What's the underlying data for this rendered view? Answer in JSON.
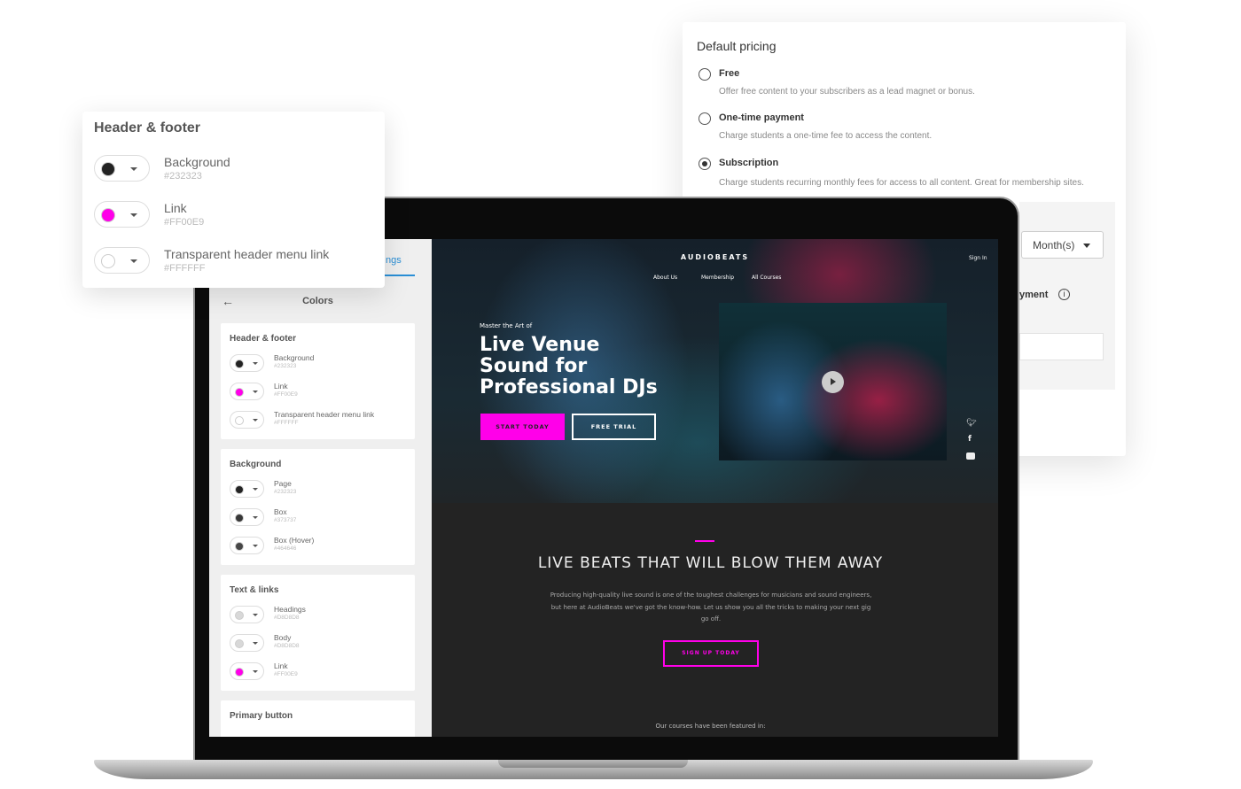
{
  "pricing": {
    "title": "Default pricing",
    "options": [
      {
        "label": "Free",
        "desc": "Offer free content to your subscribers as a lead magnet or bonus.",
        "selected": false
      },
      {
        "label": "One-time payment",
        "desc": "Charge students a one-time fee to access the content.",
        "selected": false
      },
      {
        "label": "Subscription",
        "desc": "Charge students recurring monthly fees for access to all content. Great for membership sites.",
        "selected": true
      }
    ],
    "period_select": "Month(s)",
    "partial_label": "yment",
    "info_icon": "i"
  },
  "sidebar": {
    "tab_partial": "ngs",
    "back_icon": "←",
    "title": "Colors",
    "accent": "#2A8FD6",
    "groups": [
      {
        "title": "Header & footer",
        "rows": [
          {
            "name": "Background",
            "hex": "#232323"
          },
          {
            "name": "Link",
            "hex": "#FF00E9"
          },
          {
            "name": "Transparent header menu link",
            "hex": "#FFFFFF"
          }
        ]
      },
      {
        "title": "Background",
        "rows": [
          {
            "name": "Page",
            "hex": "#232323"
          },
          {
            "name": "Box",
            "hex": "#373737"
          },
          {
            "name": "Box (Hover)",
            "hex": "#464646"
          }
        ]
      },
      {
        "title": "Text & links",
        "rows": [
          {
            "name": "Headings",
            "hex": "#D8D8D8"
          },
          {
            "name": "Body",
            "hex": "#D8D8D8"
          },
          {
            "name": "Link",
            "hex": "#FF00E9"
          }
        ]
      },
      {
        "title": "Primary button",
        "rows": []
      }
    ]
  },
  "popup": {
    "title": "Header & footer",
    "rows": [
      {
        "name": "Background",
        "hex": "#232323"
      },
      {
        "name": "Link",
        "hex": "#FF00E9"
      },
      {
        "name": "Transparent header menu link",
        "hex": "#FFFFFF"
      }
    ]
  },
  "site": {
    "logo": "AUDIOBEATS",
    "sign_in": "Sign In",
    "nav": [
      "About Us",
      "Membership",
      "All Courses"
    ],
    "kicker": "Master the Art of",
    "headline": [
      "Live Venue",
      "Sound for",
      "Professional DJs"
    ],
    "start": "START TODAY",
    "trial": "FREE TRIAL",
    "social": [
      "twitter",
      "facebook",
      "youtube"
    ],
    "section_title": "LIVE BEATS THAT WILL BLOW THEM AWAY",
    "section_body": "Producing high-quality live sound is one of the toughest challenges for musicians and sound engineers, but here at AudioBeats we've got the know-how. Let us show you all the tricks to making your next gig go off.",
    "signup": "SIGN UP TODAY",
    "featured": "Our courses have been featured in:",
    "accent": "#FF00E9"
  }
}
